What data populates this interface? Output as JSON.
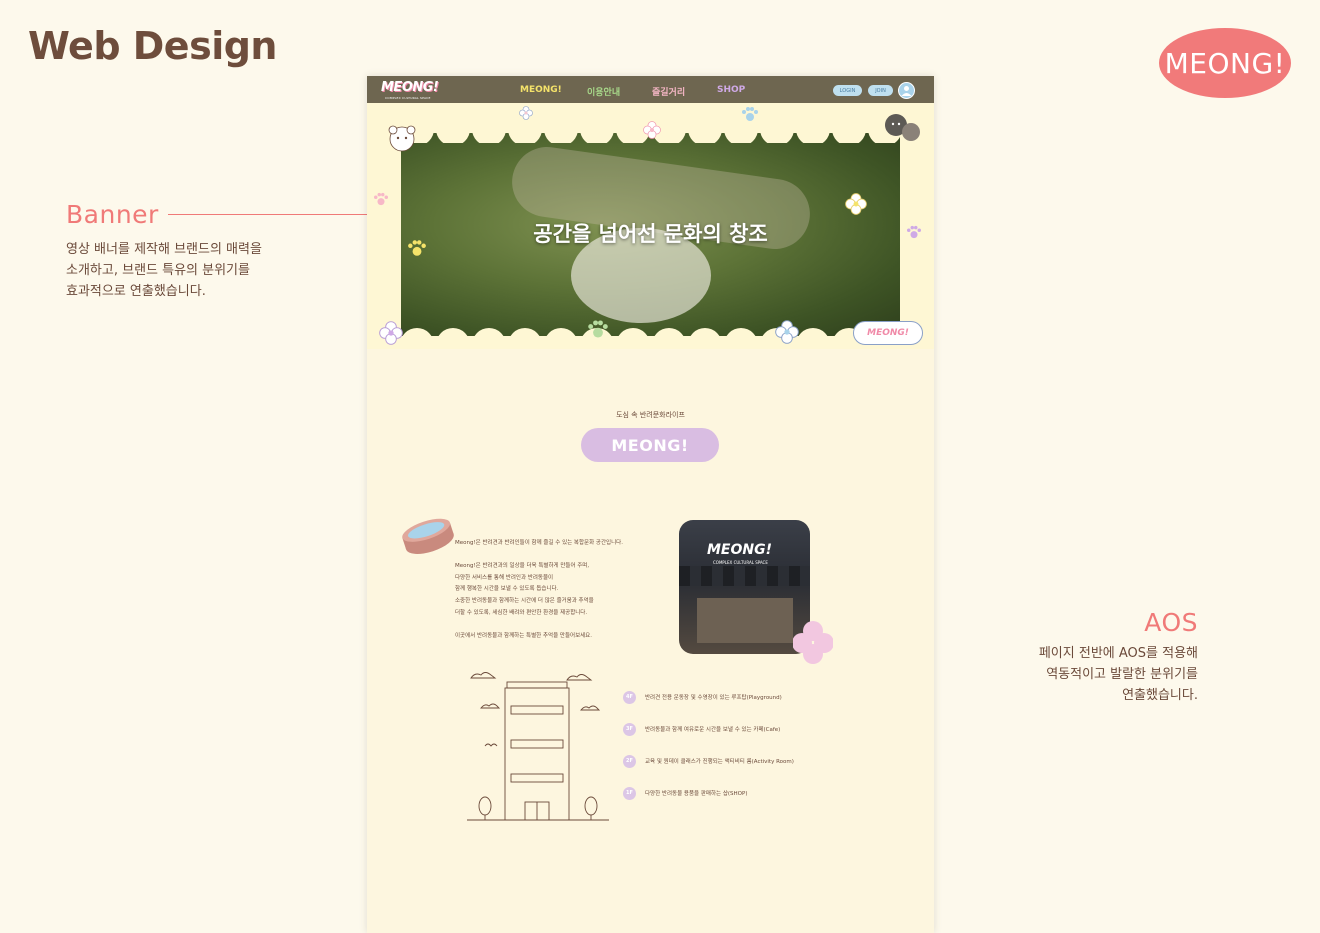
{
  "page_title": "Web Design",
  "brand_badge": "MEONG!",
  "notes": {
    "banner": {
      "title": "Banner",
      "lines": [
        "영상 배너를 제작해 브랜드의 매력을",
        "소개하고, 브랜드 특유의 분위기를",
        "효과적으로 연출했습니다."
      ]
    },
    "aos": {
      "title": "AOS",
      "lines": [
        "페이지 전반에 AOS를 적용해",
        "역동적이고 발랄한 분위기를",
        "연출했습니다."
      ]
    }
  },
  "site": {
    "logo": "MEONG!",
    "logo_sub": "COMPLEX CULTURAL SPACE",
    "nav": [
      {
        "label": "MEONG!",
        "color": "#f5e36a"
      },
      {
        "label": "이용안내",
        "color": "#a8d98a"
      },
      {
        "label": "즐길거리",
        "color": "#f7b8c7"
      },
      {
        "label": "SHOP",
        "color": "#cfa9e6"
      }
    ],
    "login": "LOGIN",
    "join": "JOIN",
    "hero_title": "공간을 넘어선 문화의 창조",
    "hero_badge_logo": "MEONG!",
    "section_tag": "도심 속 반려문화라이프",
    "section_title": "MEONG!",
    "intro": {
      "p1": "Meong!은 반려견과 반려인들이 함께 즐길 수 있는 복합문화 공간입니다.",
      "p2": [
        "Meong!은 반려견과의 일상을 더욱 특별하게 만들어 주며,",
        "다양한 서비스를 통해 반려인과 반려동물이",
        "함께 행복한 시간을 보낼 수 있도록 돕습니다.",
        "소중한 반려동물과 함께하는 시간에 더 많은 즐거움과 추억을",
        "더할 수 있도록, 세심한 배려와 편안한 환경을 제공합니다."
      ],
      "p3": "이곳에서 반려동물과 함께하는 특별한 추억을 만들어보세요."
    },
    "store_sign": "MEONG!",
    "store_sign_sub": "COMPLEX CULTURAL SPACE",
    "floors": [
      {
        "badge": "4F",
        "text": "반려견 전용 운동장 및 수영장이 있는 루프탑(Playground)"
      },
      {
        "badge": "3F",
        "text": "반려동물과 함께 여유로운 시간을 보낼 수 있는 카페(Cafe)"
      },
      {
        "badge": "2F",
        "text": "교육 및 원데이 클래스가 진행되는 액티비티 룸(Activity Room)"
      },
      {
        "badge": "1F",
        "text": "다양한 반려동물 용품을 판매하는 샵(SHOP)"
      }
    ]
  }
}
